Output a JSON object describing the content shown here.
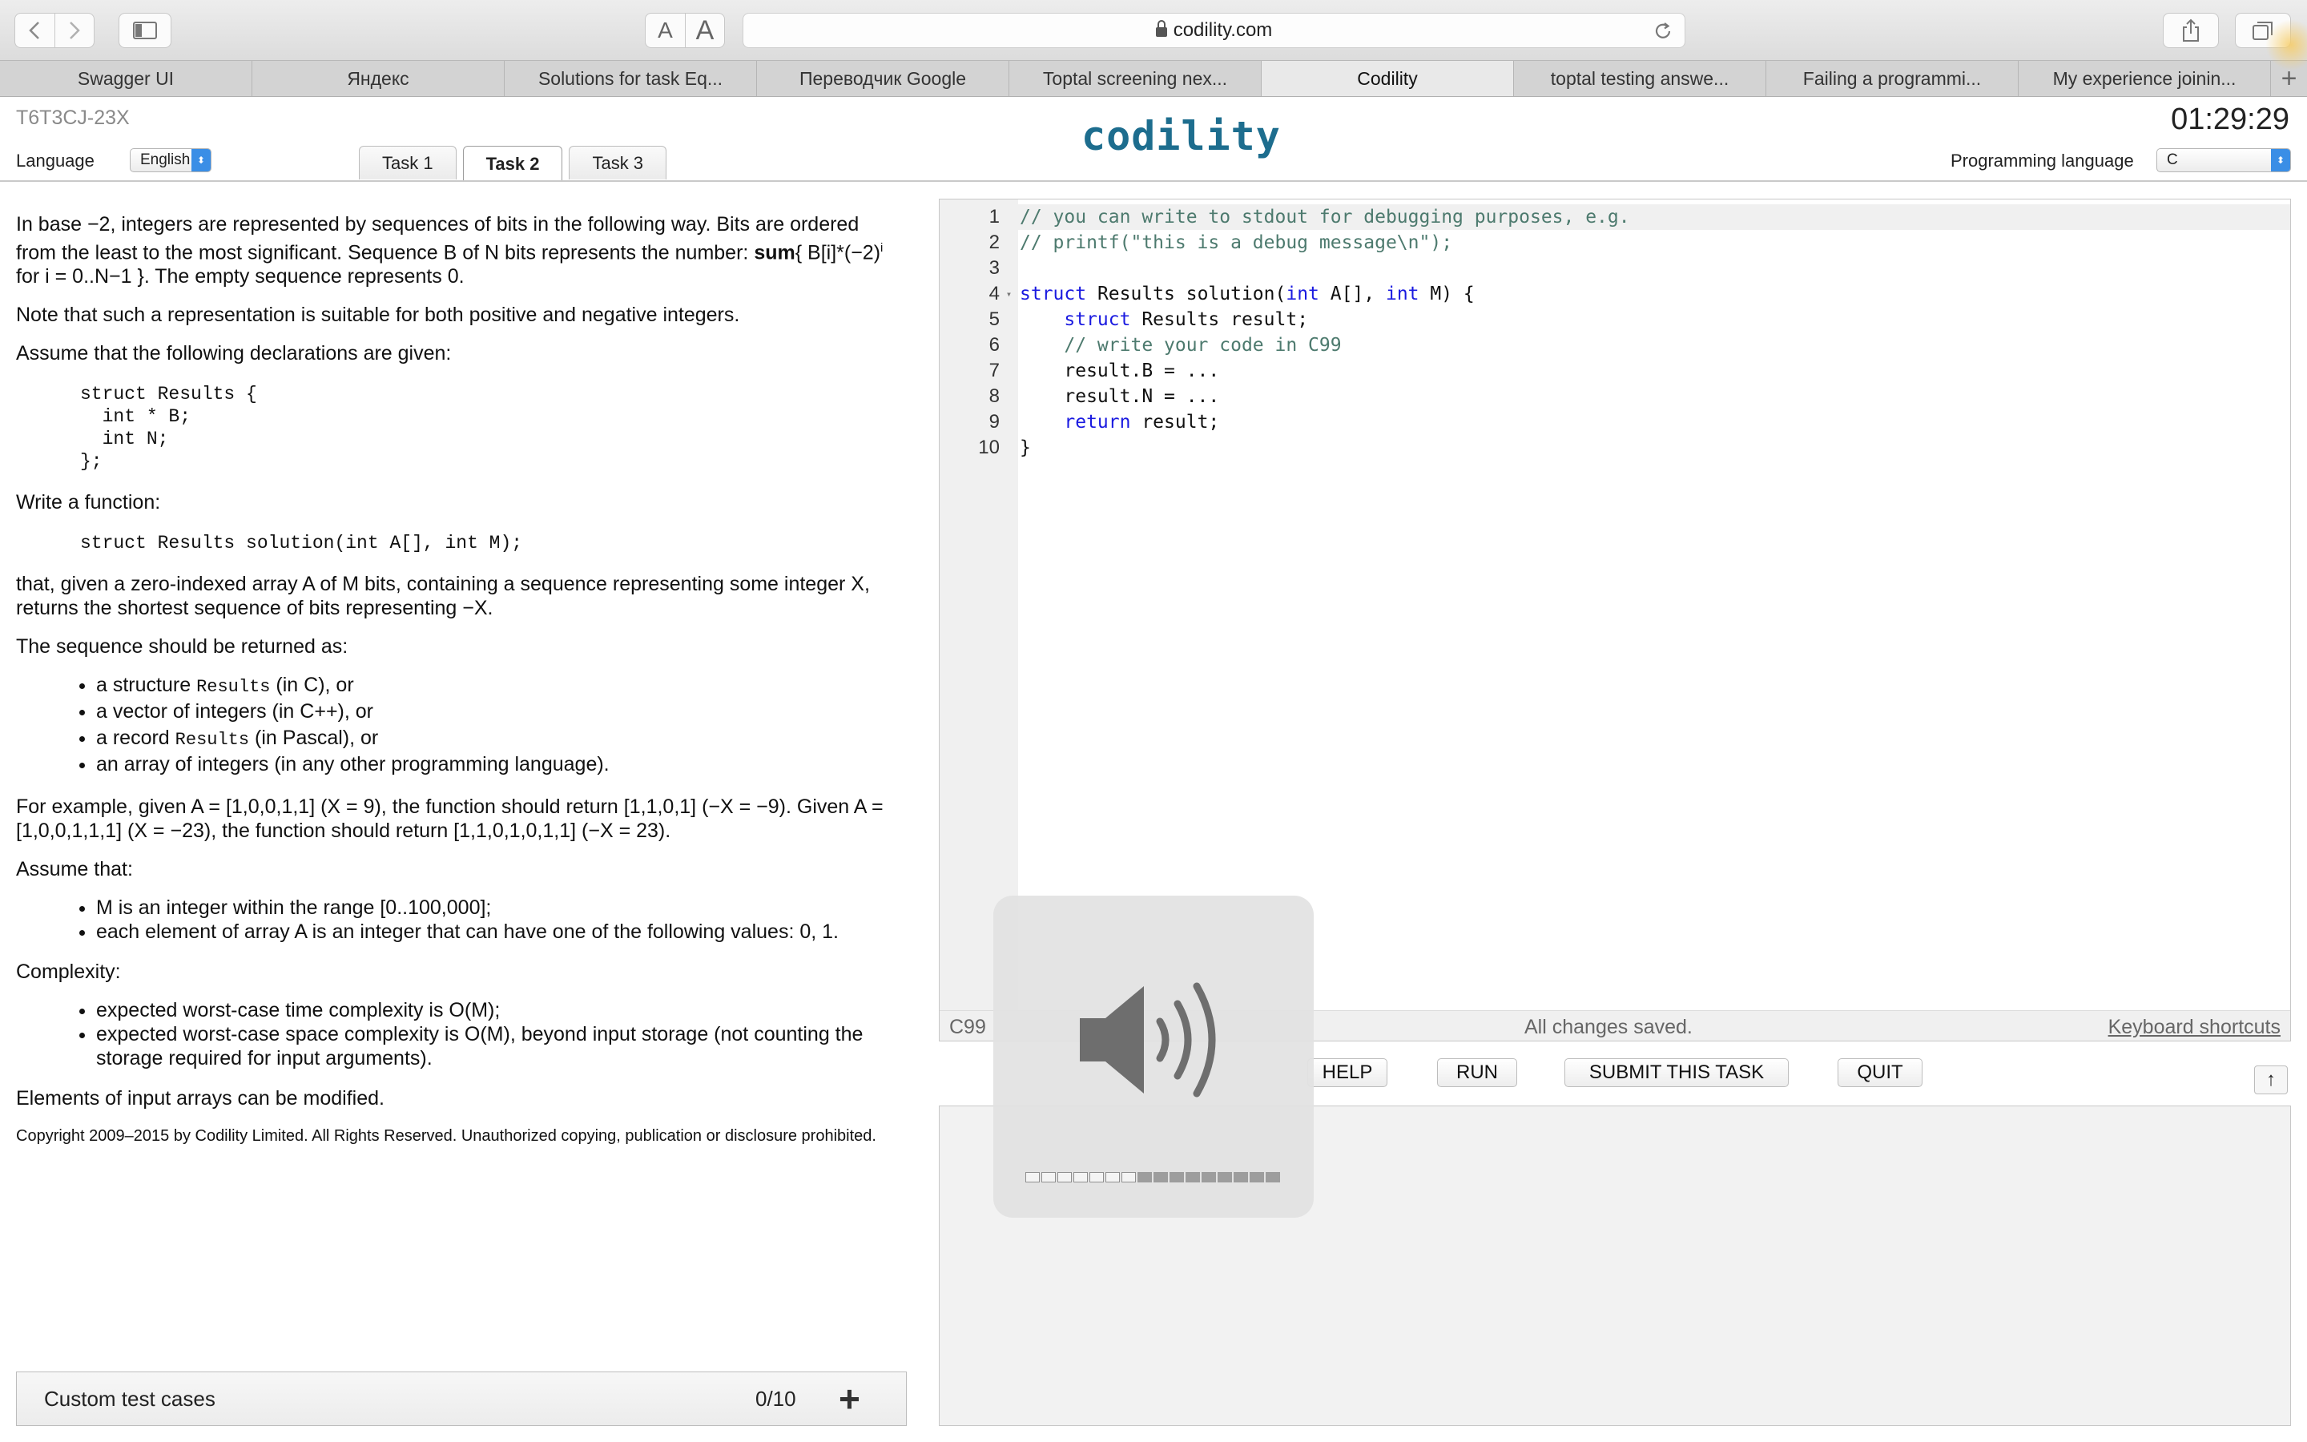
{
  "browser": {
    "url": "codility.com",
    "tabs": [
      {
        "label": "Swagger UI",
        "active": false
      },
      {
        "label": "Яндекс",
        "active": false
      },
      {
        "label": "Solutions for task Eq...",
        "active": false
      },
      {
        "label": "Переводчик Google",
        "active": false
      },
      {
        "label": "Toptal screening nex...",
        "active": false
      },
      {
        "label": "Codility",
        "active": true
      },
      {
        "label": "toptal testing answe...",
        "active": false
      },
      {
        "label": "Failing a programmi...",
        "active": false
      },
      {
        "label": "My experience joinin...",
        "active": false
      }
    ],
    "new_tab": "+",
    "font_small": "A",
    "font_large": "A"
  },
  "header": {
    "task_id": "T6T3CJ-23X",
    "timer": "01:29:29",
    "logo": "codility",
    "language_label": "Language",
    "language_value": "English",
    "programming_language_label": "Programming language",
    "programming_language_value": "C",
    "task_tabs": [
      {
        "label": "Task 1",
        "active": false
      },
      {
        "label": "Task 2",
        "active": true
      },
      {
        "label": "Task 3",
        "active": false
      }
    ]
  },
  "description": {
    "p1_pre": "In base −2, integers are represented by sequences of bits in the following way. Bits are ordered from the least to the most significant. Sequence B of N bits represents the number: ",
    "p1_sum": "sum",
    "p1_formula": "{ B[i]*(−2)",
    "p1_sup": "i",
    "p1_post": " for i = 0..N−1 }. The empty sequence represents 0.",
    "p2": "Note that such a representation is suitable for both positive and negative integers.",
    "p3": "Assume that the following declarations are given:",
    "decl_code": "struct Results {\n  int * B;\n  int N;\n};",
    "p4": "Write a function:",
    "func_code": "struct Results solution(int A[], int M);",
    "p5": "that, given a zero-indexed array A of M bits, containing a sequence representing some integer X, returns the shortest sequence of bits representing −X.",
    "p6": "The sequence should be returned as:",
    "return_items": [
      {
        "pre": "a structure ",
        "code": "Results",
        "post": " (in C), or"
      },
      {
        "pre": "a vector of integers (in C++), or",
        "code": "",
        "post": ""
      },
      {
        "pre": "a record ",
        "code": "Results",
        "post": " (in Pascal), or"
      },
      {
        "pre": "an array of integers (in any other programming language).",
        "code": "",
        "post": ""
      }
    ],
    "p7": "For example, given A = [1,0,0,1,1] (X = 9), the function should return [1,1,0,1] (−X = −9). Given A = [1,0,0,1,1,1] (X = −23), the function should return [1,1,0,1,0,1,1] (−X = 23).",
    "p8": "Assume that:",
    "assume_items": [
      "M is an integer within the range [0..100,000];",
      "each element of array A is an integer that can have one of the following values: 0, 1."
    ],
    "p9": "Complexity:",
    "complexity_items": [
      "expected worst-case time complexity is O(M);",
      "expected worst-case space complexity is O(M), beyond input storage (not counting the storage required for input arguments)."
    ],
    "p10": "Elements of input arrays can be modified.",
    "copyright": "Copyright 2009–2015 by Codility Limited. All Rights Reserved. Unauthorized copying, publication or disclosure prohibited."
  },
  "custom_tests": {
    "label": "Custom test cases",
    "count": "0/10",
    "add": "+"
  },
  "editor": {
    "lines": [
      {
        "n": "1",
        "fold": "",
        "segments": [
          {
            "t": "// you can write to stdout for debugging purposes, e.g.",
            "c": "c-comment"
          }
        ]
      },
      {
        "n": "2",
        "fold": "",
        "segments": [
          {
            "t": "// printf(\"this is a debug message\\n\");",
            "c": "c-comment"
          }
        ]
      },
      {
        "n": "3",
        "fold": "",
        "segments": []
      },
      {
        "n": "4",
        "fold": "▾",
        "segments": [
          {
            "t": "struct",
            "c": "c-kw"
          },
          {
            "t": " Results solution(",
            "c": ""
          },
          {
            "t": "int",
            "c": "c-kw"
          },
          {
            "t": " A[], ",
            "c": ""
          },
          {
            "t": "int",
            "c": "c-kw"
          },
          {
            "t": " M) {",
            "c": ""
          }
        ]
      },
      {
        "n": "5",
        "fold": "",
        "segments": [
          {
            "t": "    ",
            "c": ""
          },
          {
            "t": "struct",
            "c": "c-kw"
          },
          {
            "t": " Results result;",
            "c": ""
          }
        ]
      },
      {
        "n": "6",
        "fold": "",
        "segments": [
          {
            "t": "    // write your code in C99",
            "c": "c-comment"
          }
        ]
      },
      {
        "n": "7",
        "fold": "",
        "segments": [
          {
            "t": "    result.B = ...",
            "c": ""
          }
        ]
      },
      {
        "n": "8",
        "fold": "",
        "segments": [
          {
            "t": "    result.N = ...",
            "c": ""
          }
        ]
      },
      {
        "n": "9",
        "fold": "",
        "segments": [
          {
            "t": "    ",
            "c": ""
          },
          {
            "t": "return",
            "c": "c-kw"
          },
          {
            "t": " result;",
            "c": ""
          }
        ]
      },
      {
        "n": "10",
        "fold": "",
        "segments": [
          {
            "t": "}",
            "c": ""
          }
        ]
      }
    ],
    "status_lang": "C99",
    "status_saved": "All changes saved.",
    "keyboard_shortcuts": "Keyboard shortcuts"
  },
  "actions": {
    "help": "HELP",
    "run": "RUN",
    "submit": "SUBMIT THIS TASK",
    "quit": "QUIT",
    "scroll_up": "↑"
  },
  "volume": {
    "level": 0.44
  }
}
